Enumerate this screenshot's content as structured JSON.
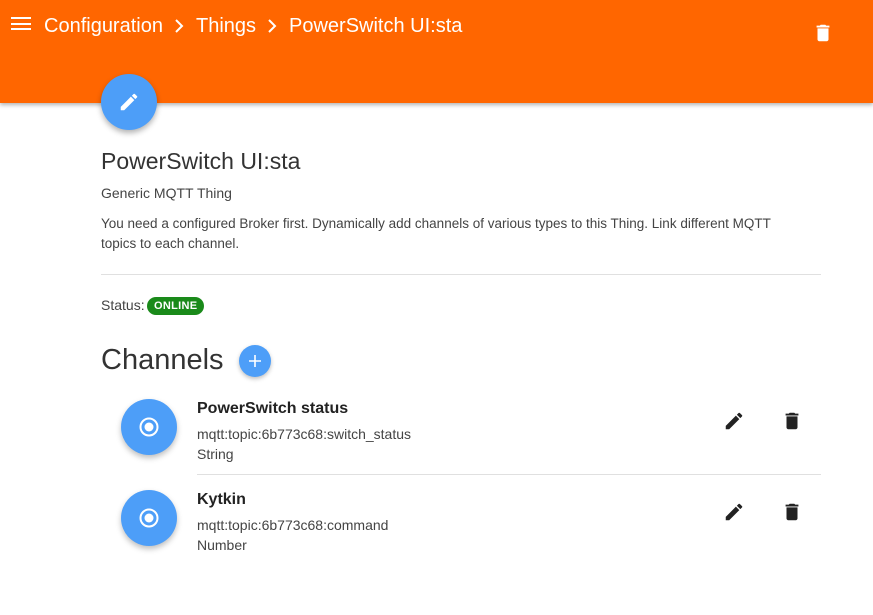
{
  "header": {
    "breadcrumbs": [
      "Configuration",
      "Things",
      "PowerSwitch UI:sta"
    ],
    "menu_icon": "hamburger-menu-icon",
    "delete_icon": "trash-icon",
    "background_color": "#ff6600"
  },
  "thing": {
    "edit_icon": "pencil-icon",
    "title": "PowerSwitch UI:sta",
    "type": "Generic MQTT Thing",
    "description": "You need a configured Broker first. Dynamically add channels of various types to this Thing. Link different MQTT topics to each channel.",
    "status_label": "Status:",
    "status_value": "ONLINE",
    "status_color": "#1a8a1a"
  },
  "channels": {
    "heading": "Channels",
    "add_icon": "plus-icon",
    "accent_color": "#4d9ef8",
    "items": [
      {
        "name": "PowerSwitch status",
        "uid": "mqtt:topic:6b773c68:switch_status",
        "type": "String",
        "icon": "radio-button-icon"
      },
      {
        "name": "Kytkin",
        "uid": "mqtt:topic:6b773c68:command",
        "type": "Number",
        "icon": "radio-button-icon"
      }
    ]
  }
}
